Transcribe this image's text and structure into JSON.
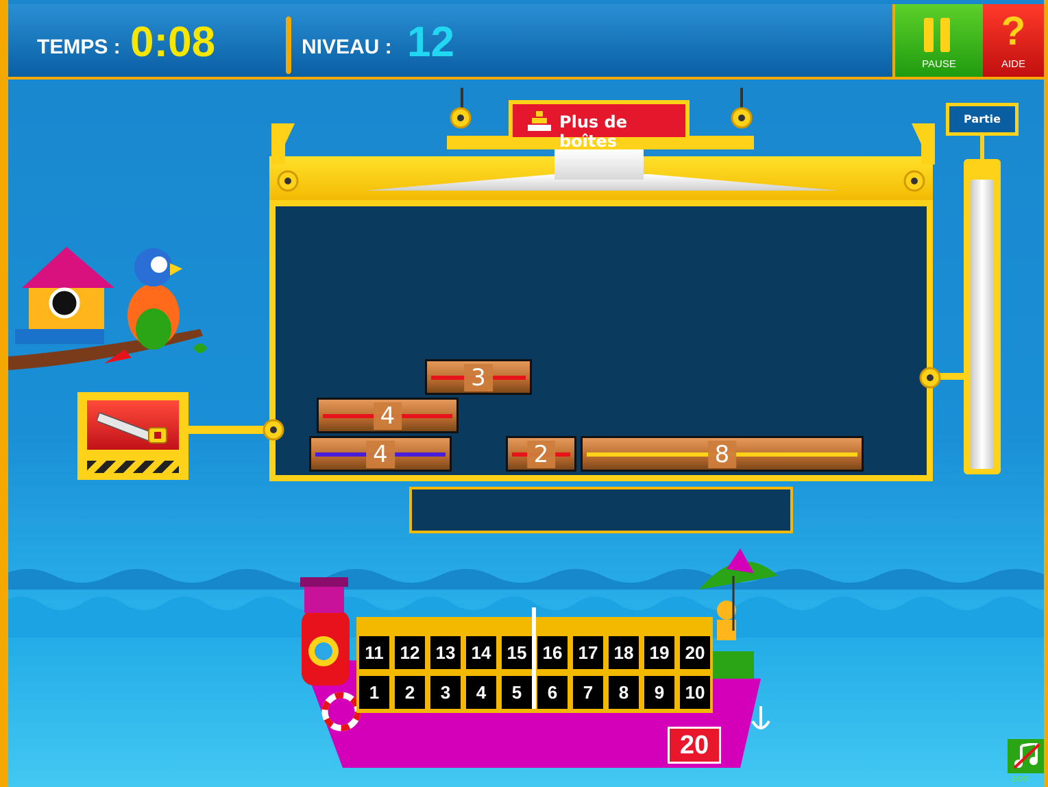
{
  "hud": {
    "temps_label": "TEMPS :",
    "temps_value": "0:08",
    "niveau_label": "NIVEAU :",
    "niveau_value": "12"
  },
  "buttons": {
    "pause_label": "PAUSE",
    "aide_label": "AIDE",
    "aide_glyph": "?",
    "more_boxes_label": "Plus de boîtes",
    "sound_label": "son"
  },
  "progress": {
    "label": "Partie"
  },
  "bars": [
    {
      "value": "3",
      "stripe": "red"
    },
    {
      "value": "4",
      "stripe": "red"
    },
    {
      "value": "4",
      "stripe": "blue"
    },
    {
      "value": "2",
      "stripe": "red"
    },
    {
      "value": "8",
      "stripe": "yellow"
    }
  ],
  "ruler": {
    "top_row": [
      "11",
      "12",
      "13",
      "14",
      "15",
      "16",
      "17",
      "18",
      "19",
      "20"
    ],
    "bottom_row": [
      "1",
      "2",
      "3",
      "4",
      "5",
      "6",
      "7",
      "8",
      "9",
      "10"
    ]
  },
  "score_value": "20",
  "colors": {
    "bar_stripe_red": "#e8121a",
    "bar_stripe_blue": "#4a1ed8",
    "bar_stripe_yellow": "#ffd21a",
    "frame_gold": "#ffd21a",
    "panel_navy": "#0a3a5e"
  }
}
